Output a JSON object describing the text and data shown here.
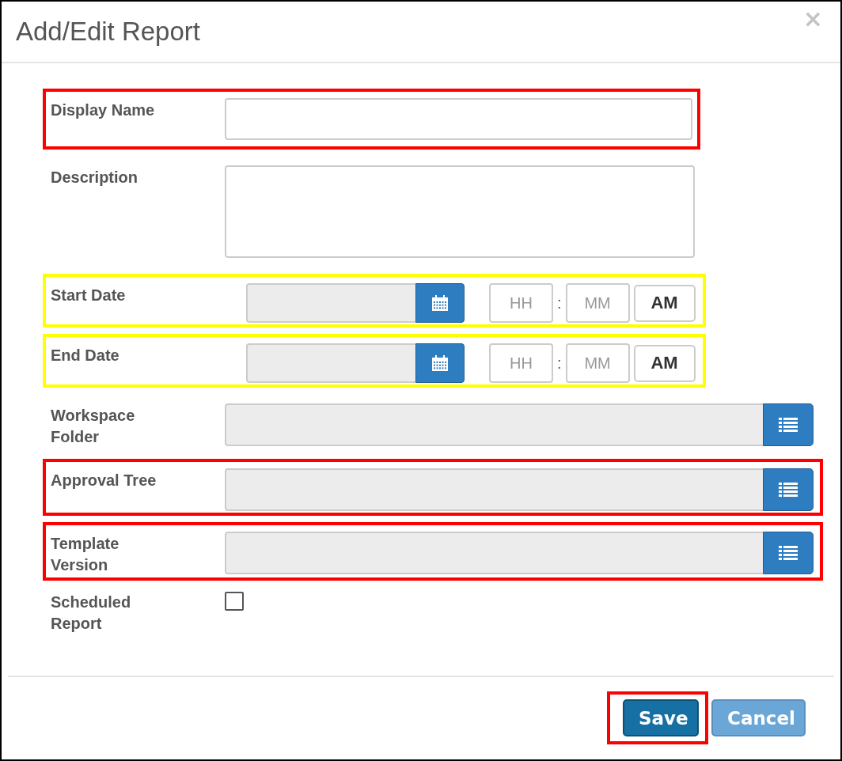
{
  "dialog": {
    "title": "Add/Edit Report",
    "close": "×"
  },
  "fields": [
    {
      "kind": "text",
      "label": "Display Name",
      "color": "#ff0000"
    },
    {
      "kind": "textarea",
      "label": "Description"
    },
    {
      "kind": "datetime",
      "label": "Start Date",
      "hour_placeholder": "HH",
      "separator": ":",
      "minute_placeholder": "MM",
      "meridiem": "AM",
      "color": "#ffff00"
    },
    {
      "kind": "datetime",
      "label": "End Date",
      "hour_placeholder": "HH",
      "separator": ":",
      "minute_placeholder": "MM",
      "meridiem": "AM",
      "color": "#ffff00"
    },
    {
      "kind": "picker",
      "label": "Workspace Folder"
    },
    {
      "kind": "picker",
      "label": "Approval Tree",
      "color": "#ff0000"
    },
    {
      "kind": "picker",
      "label": "Template Version",
      "color": "#ff0000"
    },
    {
      "kind": "checkbox",
      "label": "Scheduled Report",
      "checked": false
    }
  ],
  "buttons": [
    {
      "kind": "primary",
      "label": "Save",
      "color": "#ff0000"
    },
    {
      "kind": "secondary",
      "label": "Cancel"
    }
  ]
}
